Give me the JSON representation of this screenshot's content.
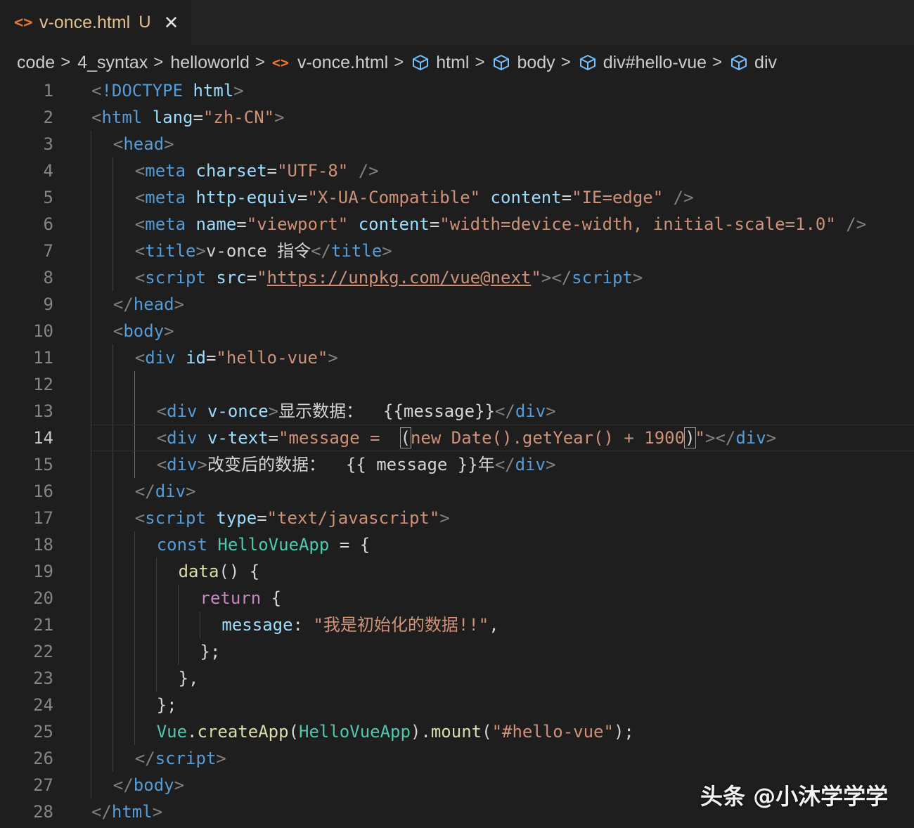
{
  "tab": {
    "icon": "html-file-icon",
    "title": "v-once.html",
    "badge": "U",
    "close": "✕"
  },
  "breadcrumb": {
    "items": [
      "code",
      "4_syntax",
      "helloworld",
      "v-once.html",
      "html",
      "body",
      "div#hello-vue",
      "div"
    ],
    "separator": ">"
  },
  "editor": {
    "active_line": 14,
    "lines": [
      [
        [
          "t-br",
          "<"
        ],
        [
          "t-tag",
          "!DOCTYPE"
        ],
        [
          "t-txt",
          " "
        ],
        [
          "t-attr",
          "html"
        ],
        [
          "t-br",
          ">"
        ]
      ],
      [
        [
          "t-br",
          "<"
        ],
        [
          "t-tag",
          "html"
        ],
        [
          "t-txt",
          " "
        ],
        [
          "t-attr",
          "lang"
        ],
        [
          "t-txt",
          "="
        ],
        [
          "t-str",
          "\"zh-CN\""
        ],
        [
          "t-br",
          ">"
        ]
      ],
      [
        [
          "t-br",
          "<"
        ],
        [
          "t-tag",
          "head"
        ],
        [
          "t-br",
          ">"
        ]
      ],
      [
        [
          "t-br",
          "<"
        ],
        [
          "t-tag",
          "meta"
        ],
        [
          "t-txt",
          " "
        ],
        [
          "t-attr",
          "charset"
        ],
        [
          "t-txt",
          "="
        ],
        [
          "t-str",
          "\"UTF-8\""
        ],
        [
          "t-txt",
          " "
        ],
        [
          "t-br",
          "/>"
        ]
      ],
      [
        [
          "t-br",
          "<"
        ],
        [
          "t-tag",
          "meta"
        ],
        [
          "t-txt",
          " "
        ],
        [
          "t-attr",
          "http-equiv"
        ],
        [
          "t-txt",
          "="
        ],
        [
          "t-str",
          "\"X-UA-Compatible\""
        ],
        [
          "t-txt",
          " "
        ],
        [
          "t-attr",
          "content"
        ],
        [
          "t-txt",
          "="
        ],
        [
          "t-str",
          "\"IE=edge\""
        ],
        [
          "t-txt",
          " "
        ],
        [
          "t-br",
          "/>"
        ]
      ],
      [
        [
          "t-br",
          "<"
        ],
        [
          "t-tag",
          "meta"
        ],
        [
          "t-txt",
          " "
        ],
        [
          "t-attr",
          "name"
        ],
        [
          "t-txt",
          "="
        ],
        [
          "t-str",
          "\"viewport\""
        ],
        [
          "t-txt",
          " "
        ],
        [
          "t-attr",
          "content"
        ],
        [
          "t-txt",
          "="
        ],
        [
          "t-str",
          "\"width=device-width, initial-scale=1.0\""
        ],
        [
          "t-txt",
          " "
        ],
        [
          "t-br",
          "/>"
        ]
      ],
      [
        [
          "t-br",
          "<"
        ],
        [
          "t-tag",
          "title"
        ],
        [
          "t-br",
          ">"
        ],
        [
          "t-txt",
          "v-once 指令"
        ],
        [
          "t-br",
          "</"
        ],
        [
          "t-tag",
          "title"
        ],
        [
          "t-br",
          ">"
        ]
      ],
      [
        [
          "t-br",
          "<"
        ],
        [
          "t-tag",
          "script"
        ],
        [
          "t-txt",
          " "
        ],
        [
          "t-attr",
          "src"
        ],
        [
          "t-txt",
          "="
        ],
        [
          "t-str",
          "\""
        ],
        [
          "t-link",
          "https://unpkg.com/vue@next"
        ],
        [
          "t-str",
          "\""
        ],
        [
          "t-br",
          "></"
        ],
        [
          "t-tag",
          "script"
        ],
        [
          "t-br",
          ">"
        ]
      ],
      [
        [
          "t-br",
          "</"
        ],
        [
          "t-tag",
          "head"
        ],
        [
          "t-br",
          ">"
        ]
      ],
      [
        [
          "t-br",
          "<"
        ],
        [
          "t-tag",
          "body"
        ],
        [
          "t-br",
          ">"
        ]
      ],
      [
        [
          "t-br",
          "<"
        ],
        [
          "t-tag",
          "div"
        ],
        [
          "t-txt",
          " "
        ],
        [
          "t-attr",
          "id"
        ],
        [
          "t-txt",
          "="
        ],
        [
          "t-str",
          "\"hello-vue\""
        ],
        [
          "t-br",
          ">"
        ]
      ],
      [],
      [
        [
          "t-br",
          "<"
        ],
        [
          "t-tag",
          "div"
        ],
        [
          "t-txt",
          " "
        ],
        [
          "t-attr",
          "v-once"
        ],
        [
          "t-br",
          ">"
        ],
        [
          "t-txt",
          "显示数据：  {{message}}"
        ],
        [
          "t-br",
          "</"
        ],
        [
          "t-tag",
          "div"
        ],
        [
          "t-br",
          ">"
        ]
      ],
      [
        [
          "t-br",
          "<"
        ],
        [
          "t-tag",
          "div"
        ],
        [
          "t-txt",
          " "
        ],
        [
          "t-attr",
          "v-text"
        ],
        [
          "t-txt",
          "="
        ],
        [
          "t-str",
          "\"message =  "
        ],
        [
          "t-bm",
          "("
        ],
        [
          "t-str",
          "new Date().getYear() + 1900"
        ],
        [
          "t-bm",
          ")"
        ],
        [
          "t-str",
          "\""
        ],
        [
          "t-br",
          "></"
        ],
        [
          "t-tag",
          "div"
        ],
        [
          "t-br",
          ">"
        ]
      ],
      [
        [
          "t-br",
          "<"
        ],
        [
          "t-tag",
          "div"
        ],
        [
          "t-br",
          ">"
        ],
        [
          "t-txt",
          "改变后的数据：  {{ message }}年"
        ],
        [
          "t-br",
          "</"
        ],
        [
          "t-tag",
          "div"
        ],
        [
          "t-br",
          ">"
        ]
      ],
      [
        [
          "t-br",
          "</"
        ],
        [
          "t-tag",
          "div"
        ],
        [
          "t-br",
          ">"
        ]
      ],
      [
        [
          "t-br",
          "<"
        ],
        [
          "t-tag",
          "script"
        ],
        [
          "t-txt",
          " "
        ],
        [
          "t-attr",
          "type"
        ],
        [
          "t-txt",
          "="
        ],
        [
          "t-str",
          "\"text/javascript\""
        ],
        [
          "t-br",
          ">"
        ]
      ],
      [
        [
          "t-kw",
          "const"
        ],
        [
          "t-txt",
          " "
        ],
        [
          "t-cls",
          "HelloVueApp"
        ],
        [
          "t-txt",
          " = {"
        ]
      ],
      [
        [
          "t-fn",
          "data"
        ],
        [
          "t-txt",
          "() {"
        ]
      ],
      [
        [
          "t-ctl",
          "return"
        ],
        [
          "t-txt",
          " {"
        ]
      ],
      [
        [
          "t-var",
          "message"
        ],
        [
          "t-txt",
          ": "
        ],
        [
          "t-str",
          "\"我是初始化的数据!!\""
        ],
        [
          "t-txt",
          ","
        ]
      ],
      [
        [
          "t-txt",
          "};"
        ]
      ],
      [
        [
          "t-txt",
          "},"
        ]
      ],
      [
        [
          "t-txt",
          "};"
        ]
      ],
      [
        [
          "t-cls",
          "Vue"
        ],
        [
          "t-txt",
          "."
        ],
        [
          "t-fn",
          "createApp"
        ],
        [
          "t-txt",
          "("
        ],
        [
          "t-cls",
          "HelloVueApp"
        ],
        [
          "t-txt",
          ")."
        ],
        [
          "t-fn",
          "mount"
        ],
        [
          "t-txt",
          "("
        ],
        [
          "t-str",
          "\"#hello-vue\""
        ],
        [
          "t-txt",
          ");"
        ]
      ],
      [
        [
          "t-br",
          "</"
        ],
        [
          "t-tag",
          "script"
        ],
        [
          "t-br",
          ">"
        ]
      ],
      [
        [
          "t-br",
          "</"
        ],
        [
          "t-tag",
          "body"
        ],
        [
          "t-br",
          ">"
        ]
      ],
      [
        [
          "t-br",
          "</"
        ],
        [
          "t-tag",
          "html"
        ],
        [
          "t-br",
          ">"
        ]
      ]
    ]
  },
  "watermark": "头条 @小沐学学学"
}
